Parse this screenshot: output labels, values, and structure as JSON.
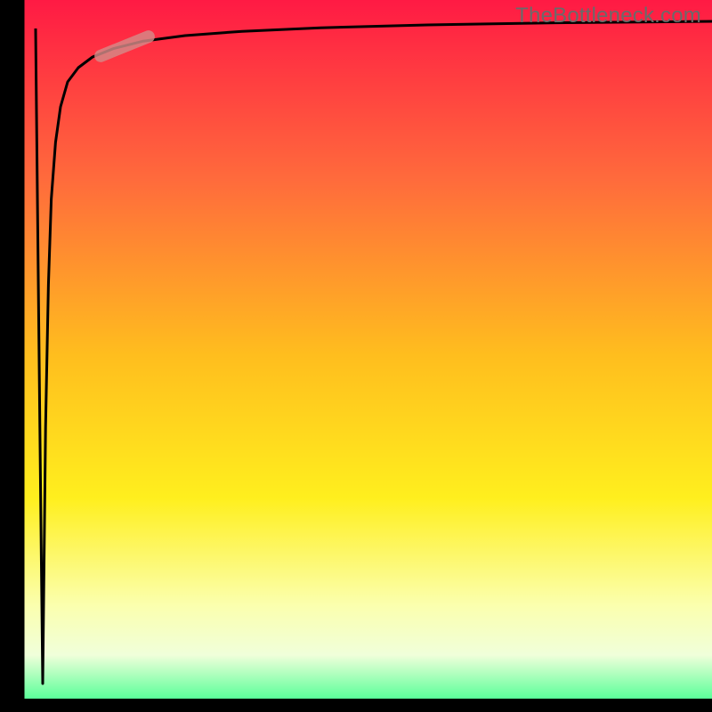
{
  "watermark": "TheBottleneck.com",
  "chart_data": {
    "type": "line",
    "title": "",
    "xlabel": "",
    "ylabel": "",
    "xlim": [
      0,
      100
    ],
    "ylim": [
      0,
      100
    ],
    "grid": false,
    "background_gradient": {
      "stops": [
        {
          "offset": 0.0,
          "color": "#ff1a44"
        },
        {
          "offset": 0.25,
          "color": "#ff6a3c"
        },
        {
          "offset": 0.5,
          "color": "#ffbe1e"
        },
        {
          "offset": 0.7,
          "color": "#ffef1e"
        },
        {
          "offset": 0.85,
          "color": "#fbffae"
        },
        {
          "offset": 0.92,
          "color": "#f0ffda"
        },
        {
          "offset": 1.0,
          "color": "#2dff86"
        }
      ]
    },
    "series": [
      {
        "name": "left-border",
        "type": "line",
        "x": [
          0,
          0
        ],
        "y": [
          0,
          100
        ],
        "stroke": "#000000",
        "stroke_width": 55
      },
      {
        "name": "bottom-border",
        "type": "line",
        "x": [
          0,
          100
        ],
        "y": [
          0,
          0
        ],
        "stroke": "#000000",
        "stroke_width": 30
      },
      {
        "name": "dip-curve",
        "type": "line",
        "x": [
          5.0,
          5.6,
          6.0,
          6.4,
          6.8,
          7.2,
          7.8,
          8.5,
          9.5,
          11.0,
          13.0,
          16.0,
          20.0,
          26.0,
          34.0,
          45.0,
          60.0,
          78.0,
          100.0
        ],
        "y": [
          96.0,
          40.0,
          4.0,
          40.0,
          60.0,
          72.0,
          80.0,
          85.0,
          88.5,
          90.5,
          92.0,
          93.2,
          94.2,
          95.0,
          95.6,
          96.1,
          96.5,
          96.8,
          97.0
        ],
        "stroke": "#000000",
        "stroke_width": 3
      }
    ],
    "highlight_marker": {
      "x": 17.5,
      "y": 93.5,
      "length": 9,
      "width": 14,
      "angle_deg": -22,
      "fill": "#d48a88",
      "opacity": 0.82
    }
  }
}
